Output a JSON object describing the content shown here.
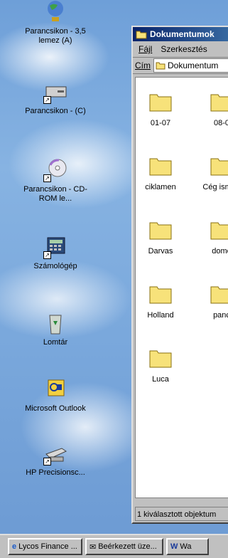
{
  "desktop": {
    "icons": [
      {
        "name": "floppy-shortcut",
        "label": "Parancsikon - 3,5 lemez (A)"
      },
      {
        "name": "drive-c-shortcut",
        "label": "Parancsikon - (C)"
      },
      {
        "name": "cdrom-shortcut",
        "label": "Parancsikon - CD-ROM le..."
      },
      {
        "name": "calculator-shortcut",
        "label": "Számológép"
      },
      {
        "name": "recycle-bin",
        "label": "Lomtár"
      },
      {
        "name": "outlook",
        "label": "Microsoft Outlook"
      },
      {
        "name": "hp-precisionscan-shortcut",
        "label": "HP Precisionsc..."
      }
    ]
  },
  "window": {
    "title": "Dokumentumok",
    "menu": {
      "file": "Fájl",
      "edit": "Szerkesztés"
    },
    "address": {
      "label": "Cím",
      "value": "Dokumentum"
    },
    "folders": [
      "01-07",
      "08-0",
      "ciklamen",
      "Cég ismert",
      "Darvas",
      "dome",
      "Holland",
      "panc",
      "Luca"
    ],
    "status": "1 kiválasztott objektum"
  },
  "taskbar": {
    "items": [
      {
        "label": "Lycos Finance ..."
      },
      {
        "label": "Beérkezett üze..."
      },
      {
        "label": "Wa"
      }
    ]
  },
  "colors": {
    "titlebar": "#0a246a",
    "desktop": "#7aa8dc",
    "folder": "#f7e27a"
  }
}
